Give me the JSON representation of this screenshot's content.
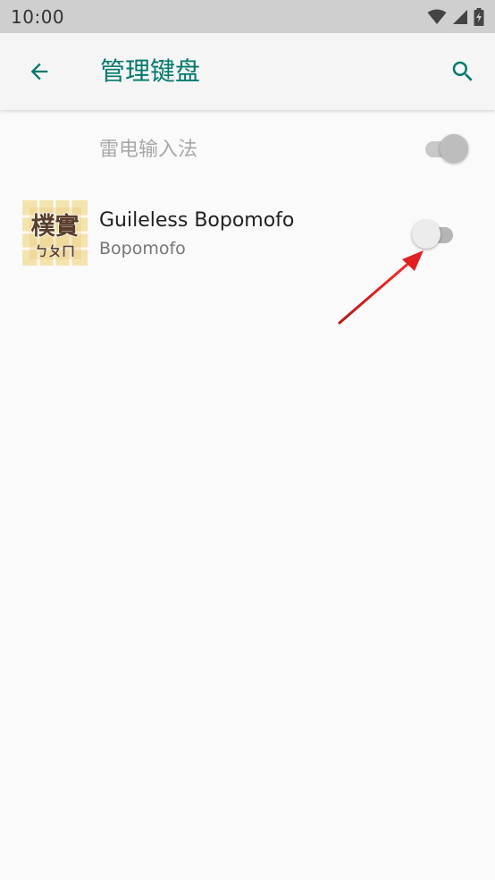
{
  "status_bar": {
    "time": "10:00",
    "icons": [
      "wifi-icon",
      "cellular-signal-icon",
      "battery-charging-icon"
    ]
  },
  "app_bar": {
    "title": "管理键盘",
    "back_icon": "arrow-back-icon",
    "search_icon": "search-icon"
  },
  "keyboards": [
    {
      "title": "雷电输入法",
      "subtitle": "",
      "enabled": true,
      "disabled_row": true
    },
    {
      "title": "Guileless Bopomofo",
      "subtitle": "Bopomofo",
      "enabled": false,
      "icon_text_top": "樸實",
      "icon_text_bottom": "ㄅㄆㄇ"
    }
  ],
  "colors": {
    "accent": "#00796b",
    "annotation_arrow": "#e02020"
  }
}
